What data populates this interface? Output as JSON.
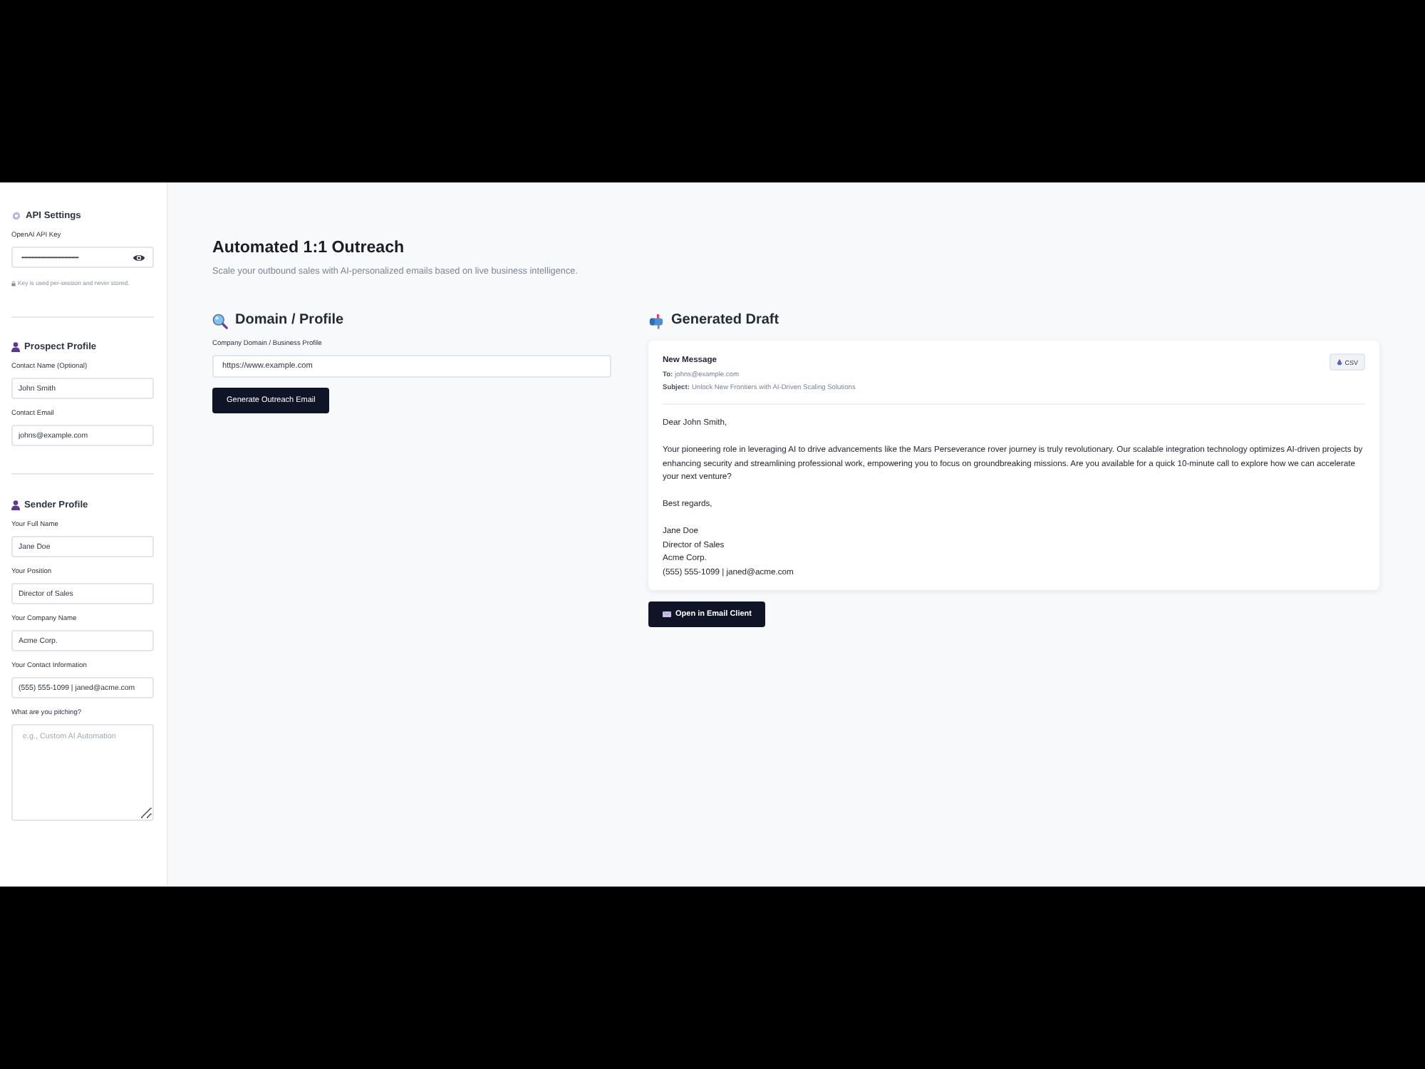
{
  "sidebar": {
    "api_settings": {
      "title": "API Settings",
      "label": "OpenAI API Key",
      "value": "••••••••••••••••••••••••••••••••••••••••",
      "note": "Key is used per-session and never stored."
    },
    "prospect_profile": {
      "title": "Prospect Profile",
      "fields": [
        {
          "label": "Contact Name (Optional)",
          "value": "John Smith"
        },
        {
          "label": "Contact Email",
          "value": "johns@example.com"
        }
      ]
    },
    "sender_profile": {
      "title": "Sender Profile",
      "fields": [
        {
          "kind": "input",
          "label": "Your Full Name",
          "value": "Jane Doe"
        },
        {
          "kind": "input",
          "label": "Your Position",
          "value": "Director of Sales"
        },
        {
          "kind": "input",
          "label": "Your Company Name",
          "value": "Acme Corp."
        },
        {
          "kind": "input",
          "label": "Your Contact Information",
          "value": "(555) 555-1099 | janed@acme.com"
        },
        {
          "kind": "textarea",
          "label": "What are you pitching?",
          "placeholder": "e.g., Custom AI Automation"
        }
      ]
    }
  },
  "header": {
    "title": "Automated 1:1 Outreach",
    "subtitle": "Scale your outbound sales with AI-personalized emails based on live business intelligence."
  },
  "domain_panel": {
    "title": "Domain / Profile",
    "label": "Company Domain / Business Profile",
    "value": "https://www.example.com",
    "button": "Generate Outreach Email"
  },
  "draft_panel": {
    "title": "Generated Draft",
    "message_title": "New Message",
    "export_button": "CSV",
    "headers": [
      {
        "label": "To:",
        "value": "johns@example.com"
      },
      {
        "label": "Subject:",
        "value": "Unlock New Frontiers with AI-Driven Scaling Solutions"
      }
    ],
    "greeting": "Dear John Smith,",
    "paragraph": "Your pioneering role in leveraging AI to drive advancements like the Mars Perseverance rover journey is truly revolutionary. Our scalable integration technology optimizes AI-driven projects by enhancing security and streamlining professional work, empowering you to focus on groundbreaking missions. Are you available for a quick 10-minute call to explore how we can accelerate your next venture?",
    "closing": "Best regards,",
    "signature": [
      "Jane Doe",
      "Director of Sales",
      "Acme Corp.",
      "(555) 555-1099 | janed@acme.com"
    ],
    "button": "Open in Email Client"
  }
}
